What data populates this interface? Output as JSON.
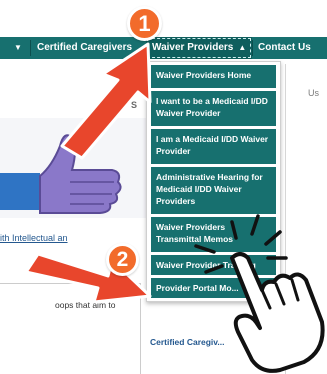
{
  "colors": {
    "nav_bg": "#17706f",
    "menu_item_bg": "#17706f",
    "accent_annotation": "#f26b2b"
  },
  "navbar": {
    "certified_caregivers": "Certified Caregivers",
    "waiver_providers": "Waiver Providers",
    "contact_us": "Contact Us"
  },
  "dropdown": {
    "items": [
      "Waiver Providers Home",
      "I want to be a Medicaid I/DD Waiver Provider",
      "I am a Medicaid I/DD Waiver Provider",
      "Administrative Hearing for Medicaid I/DD Waiver Providers",
      "Waiver Providers Transmittal Memos",
      "Waiver Provider Training",
      "Provider Portal Mo..."
    ]
  },
  "background": {
    "link_text": "ith Intellectual an",
    "body_text_1": "oops that aim to",
    "left_edge": "S",
    "right_panel_text": "Us",
    "below_menu_link": "Certified Caregiv..."
  },
  "annotations": {
    "step1": "1",
    "step2": "2"
  }
}
